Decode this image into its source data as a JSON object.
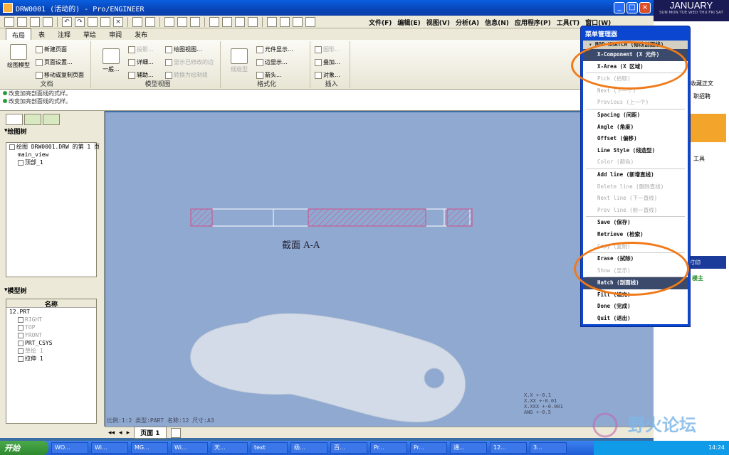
{
  "window": {
    "title": "DRW0001 (活动的) - Pro/ENGINEER"
  },
  "menus": [
    "文件(F)",
    "编辑(E)",
    "视图(V)",
    "分析(A)",
    "信息(N)",
    "应用程序(P)",
    "工具(T)",
    "窗口(W)"
  ],
  "tabs": [
    "布局",
    "表",
    "注释",
    "草绘",
    "审阅",
    "发布"
  ],
  "ribbon": {
    "doc_group": "文档",
    "model_view_group": "模型视图",
    "format_group": "格式化",
    "insert_group": "插入",
    "drawing_model": "绘图模型",
    "new_page": "新建页面",
    "page_setup": "页面设置...",
    "move_copy_page": "移动或复制页面",
    "general": "一般...",
    "projection": "投影...",
    "detail": "详细...",
    "auxiliary": "辅助...",
    "drawing_view": "绘图视图...",
    "show_modified_edges": "显示已修改的边",
    "convert_to_sketch": "转换为绘制组",
    "line_style": "线造型",
    "element_display": "元件显示...",
    "edge_display": "边显示...",
    "arrow": "箭头...",
    "graph": "图形...",
    "overlay": "叠加...",
    "object": "对象..."
  },
  "messages": [
    "改变加亮剖面线的式样。",
    "改变加亮剖面线的式样。"
  ],
  "left_panel": {
    "drawing_tree_title": "绘图树",
    "drawing_tree": [
      "绘图 DRW0001.DRW 的第 1 页",
      "main_view",
      "顶部_1"
    ],
    "model_tree_title": "模型树",
    "name_col": "名称",
    "model_tree": [
      "12.PRT",
      "RIGHT",
      "TOP",
      "FRONT",
      "PRT_CSYS",
      "草绘 1",
      "拉伸 1"
    ]
  },
  "canvas": {
    "section_label": "截面  A-A",
    "status": "比例:1:2  类型:PART  名称:12  尺寸:A3",
    "tolerances": [
      "X.X   +-0.1",
      "X.XX  +-0.01",
      "X.XXX +-0.001",
      "ANG   +-0.5"
    ]
  },
  "page_bar": {
    "page_label": "页面 1"
  },
  "menu_manager": {
    "title": "菜单管理器",
    "header": "MOD XHATCH (修改剖面线)",
    "items": [
      {
        "label": "X-Component (X 元件)",
        "state": "selected"
      },
      {
        "label": "X-Area (X 区域)",
        "state": "enabled"
      },
      {
        "label": "Pick (拾取)",
        "state": "disabled"
      },
      {
        "label": "Next (下一个)",
        "state": "disabled"
      },
      {
        "label": "Previous (上一个)",
        "state": "disabled"
      },
      {
        "label": "Spacing (间距)",
        "state": "enabled"
      },
      {
        "label": "Angle (角度)",
        "state": "enabled"
      },
      {
        "label": "Offset (偏移)",
        "state": "enabled"
      },
      {
        "label": "Line Style (线造型)",
        "state": "enabled"
      },
      {
        "label": "Color (颜色)",
        "state": "disabled"
      },
      {
        "label": "Add line (新增直线)",
        "state": "enabled"
      },
      {
        "label": "Delete line (删除直线)",
        "state": "disabled"
      },
      {
        "label": "Next line (下一直线)",
        "state": "disabled"
      },
      {
        "label": "Prev line (前一直线)",
        "state": "disabled"
      },
      {
        "label": "Save (保存)",
        "state": "enabled"
      },
      {
        "label": "Retrieve (检索)",
        "state": "enabled"
      },
      {
        "label": "Copy (复制)",
        "state": "disabled"
      },
      {
        "label": "Erase (拭除)",
        "state": "enabled"
      },
      {
        "label": "Show (显示)",
        "state": "disabled"
      },
      {
        "label": "Hatch (剖面线)",
        "state": "selected"
      },
      {
        "label": "Fill (填充)",
        "state": "enabled"
      },
      {
        "label": "Done (完成)",
        "state": "enabled"
      },
      {
        "label": "Quit (退出)",
        "state": "enabled"
      }
    ]
  },
  "calendar": {
    "month": "JANUARY",
    "days": "SUN MON TUE WED THU FRI SAT"
  },
  "browser": [
    "收藏正文",
    "职招聘",
    "工具",
    "打印",
    "楼主"
  ],
  "taskbar": {
    "start": "开始",
    "tasks": [
      "WO...",
      "Wi...",
      "MG...",
      "Wi...",
      "天...",
      "text",
      "杨...",
      "百...",
      "Pr...",
      "Pr...",
      "通...",
      "12...",
      "3..."
    ],
    "clock": "14:24"
  },
  "watermark": "野火论坛",
  "colors": {
    "canvas_bg": "#8fa9d1",
    "hatch": "#d0508a",
    "part": "#d3dbe8",
    "annotation": "#f07a1a"
  }
}
